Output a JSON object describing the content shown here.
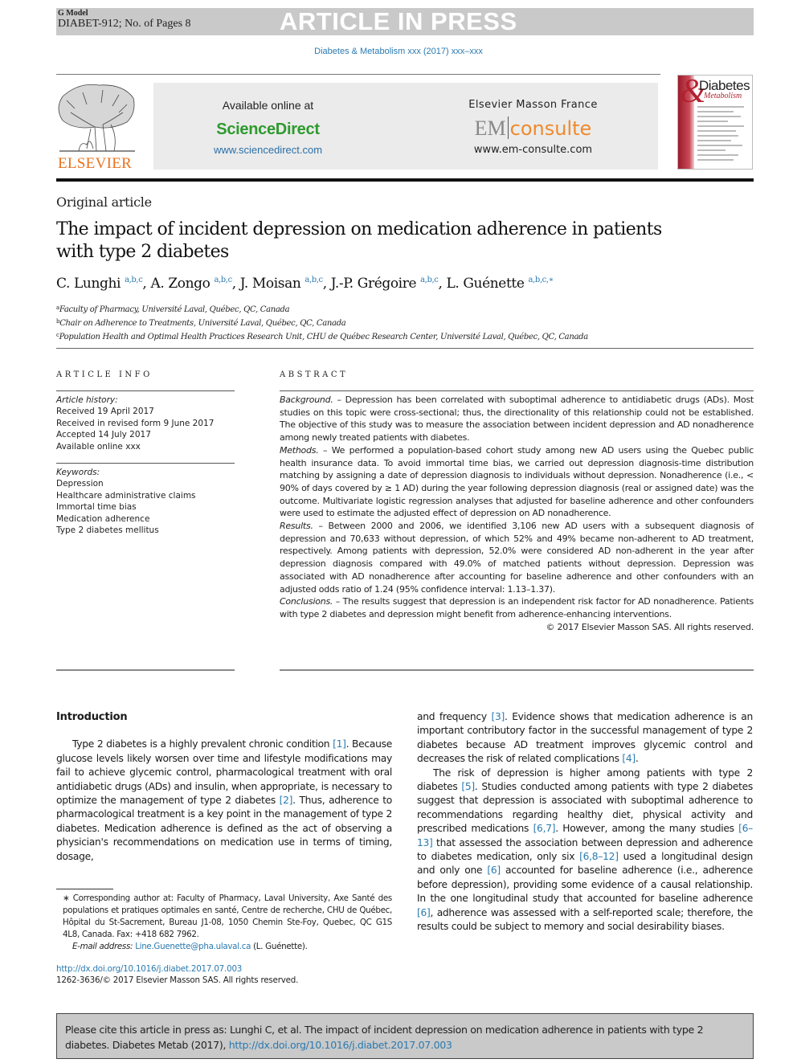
{
  "banner": {
    "model": "G Model",
    "doc_id": "DIABET-912; No. of Pages 8",
    "status": "ARTICLE IN PRESS"
  },
  "journal_line": "Diabetes & Metabolism xxx (2017) xxx–xxx",
  "publisher": {
    "logo_word": "ELSEVIER",
    "available_online": "Available online at",
    "sciencedirect": "ScienceDirect",
    "sciencedirect_url": "www.sciencedirect.com",
    "masson": "Elsevier Masson France",
    "em": "EM",
    "consulte": "consulte",
    "emconsulte_url": "www.em-consulte.com"
  },
  "cover": {
    "amp": "&",
    "title1": "Diabetes",
    "title2": "Metabolism"
  },
  "article": {
    "type": "Original article",
    "title": "The impact of incident depression on medication adherence in patients with type 2 diabetes",
    "authors": [
      {
        "name": "C. Lunghi",
        "sup": "a,b,c",
        "sep": ", "
      },
      {
        "name": "A. Zongo",
        "sup": "a,b,c",
        "sep": ", "
      },
      {
        "name": "J. Moisan",
        "sup": "a,b,c",
        "sep": ", "
      },
      {
        "name": "J.-P. Grégoire",
        "sup": "a,b,c",
        "sep": ", "
      },
      {
        "name": "L. Guénette",
        "sup": "a,b,c,∗",
        "sep": ""
      }
    ],
    "affiliations": [
      {
        "key": "a",
        "text": "Faculty of Pharmacy, Université Laval, Québec, QC, Canada"
      },
      {
        "key": "b",
        "text": "Chair on Adherence to Treatments, Université Laval, Québec, QC, Canada"
      },
      {
        "key": "c",
        "text": "Population Health and Optimal Health Practices Research Unit, CHU de Québec Research Center, Université Laval, Québec, QC, Canada"
      }
    ]
  },
  "article_info": {
    "heading": "ARTICLE INFO",
    "history_label": "Article history:",
    "history": [
      "Received 19 April 2017",
      "Received in revised form 9 June 2017",
      "Accepted 14 July 2017",
      "Available online xxx"
    ],
    "keywords_label": "Keywords:",
    "keywords": [
      "Depression",
      "Healthcare administrative claims",
      "Immortal time bias",
      "Medication adherence",
      "Type 2 diabetes mellitus"
    ]
  },
  "abstract": {
    "heading": "ABSTRACT",
    "sections": [
      {
        "label": "Background.",
        "text": " – Depression has been correlated with suboptimal adherence to antidiabetic drugs (ADs). Most studies on this topic were cross-sectional; thus, the directionality of this relationship could not be established. The objective of this study was to measure the association between incident depression and AD nonadherence among newly treated patients with diabetes."
      },
      {
        "label": "Methods.",
        "text": " – We performed a population-based cohort study among new AD users using the Quebec public health insurance data. To avoid immortal time bias, we carried out depression diagnosis-time distribution matching by assigning a date of depression diagnosis to individuals without depression. Nonadherence (i.e., < 90% of days covered by ≥ 1 AD) during the year following depression diagnosis (real or assigned date) was the outcome. Multivariate logistic regression analyses that adjusted for baseline adherence and other confounders were used to estimate the adjusted effect of depression on AD nonadherence."
      },
      {
        "label": "Results.",
        "text": " – Between 2000 and 2006, we identified 3,106 new AD users with a subsequent diagnosis of depression and 70,633 without depression, of which 52% and 49% became non-adherent to AD treatment, respectively. Among patients with depression, 52.0% were considered AD non-adherent in the year after depression diagnosis compared with 49.0% of matched patients without depression. Depression was associated with AD nonadherence after accounting for baseline adherence and other confounders with an adjusted odds ratio of 1.24 (95% confidence interval: 1.13–1.37)."
      },
      {
        "label": "Conclusions.",
        "text": " – The results suggest that depression is an independent risk factor for AD nonadherence. Patients with type 2 diabetes and depression might benefit from adherence-enhancing interventions."
      }
    ],
    "copyright": "© 2017 Elsevier Masson SAS. All rights reserved."
  },
  "body": {
    "intro_heading": "Introduction",
    "left_para": [
      {
        "t": "Type 2 diabetes is a highly prevalent chronic condition "
      },
      {
        "r": "[1]"
      },
      {
        "t": ". Because glucose levels likely worsen over time and lifestyle modifications may fail to achieve glycemic control, pharmacological treatment with oral antidiabetic drugs (ADs) and insulin, when appropriate, is necessary to optimize the management of type 2 diabetes "
      },
      {
        "r": "[2]"
      },
      {
        "t": ". Thus, adherence to pharmacological treatment is a key point in the management of type 2 diabetes. Medication adherence is defined as the act of observing a physician's recommendations on medication use in terms of timing, dosage,"
      }
    ],
    "right_para1": [
      {
        "t": "and frequency "
      },
      {
        "r": "[3]"
      },
      {
        "t": ". Evidence shows that medication adherence is an important contributory factor in the successful management of type 2 diabetes because AD treatment improves glycemic control and decreases the risk of related complications "
      },
      {
        "r": "[4]"
      },
      {
        "t": "."
      }
    ],
    "right_para2": [
      {
        "t": "The risk of depression is higher among patients with type 2 diabetes "
      },
      {
        "r": "[5]"
      },
      {
        "t": ". Studies conducted among patients with type 2 diabetes suggest that depression is associated with suboptimal adherence to recommendations regarding healthy diet, physical activity and prescribed medications "
      },
      {
        "r": "[6,7]"
      },
      {
        "t": ". However, among the many studies "
      },
      {
        "r": "[6–13]"
      },
      {
        "t": " that assessed the association between depression and adherence to diabetes medication, only six "
      },
      {
        "r": "[6,8–12]"
      },
      {
        "t": " used a longitudinal design and only one "
      },
      {
        "r": "[6]"
      },
      {
        "t": " accounted for baseline adherence (i.e., adherence before depression), providing some evidence of a causal relationship. In the one longitudinal study that accounted for baseline adherence "
      },
      {
        "r": "[6]"
      },
      {
        "t": ", adherence was assessed with a self-reported scale; therefore, the results could be subject to memory and social desirability biases."
      }
    ]
  },
  "footnote": {
    "star": "∗",
    "corresponding": " Corresponding author at: Faculty of Pharmacy, Laval University, Axe Santé des populations et pratiques optimales en santé, Centre de recherche, CHU de Québec, Hôpital du St-Sacrement, Bureau J1-08, 1050 Chemin Ste-Foy, Quebec, QC G1S 4L8, Canada. Fax: +418 682 7962.",
    "email_label": "E-mail address:",
    "email": "Line.Guenette@pha.ulaval.ca",
    "email_suffix": " (L. Guénette)."
  },
  "doi": {
    "url": "http://dx.doi.org/10.1016/j.diabet.2017.07.003",
    "issn": "1262-3636/© 2017 Elsevier Masson SAS. All rights reserved."
  },
  "citation": {
    "text": "Please cite this article in press as: Lunghi C, et al. The impact of incident depression on medication adherence in patients with type 2 diabetes. Diabetes Metab (2017), ",
    "url": "http://dx.doi.org/10.1016/j.diabet.2017.07.003"
  }
}
